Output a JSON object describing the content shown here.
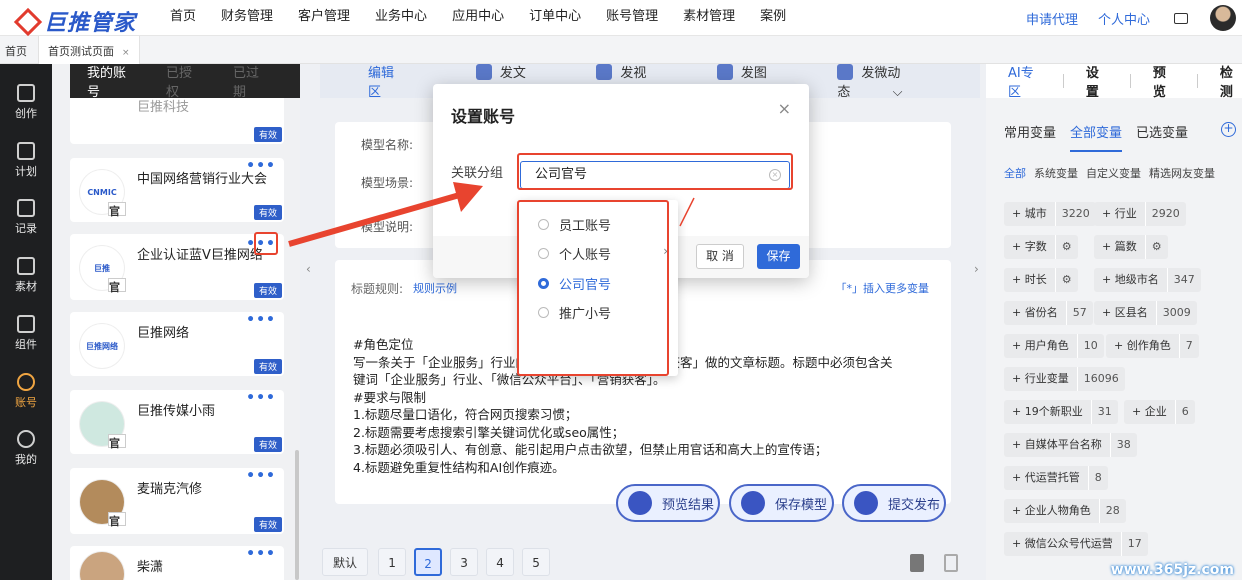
{
  "header": {
    "logo": "巨推管家",
    "nav": [
      "首页",
      "财务管理",
      "客户管理",
      "业务中心",
      "应用中心",
      "订单中心",
      "账号管理",
      "素材管理",
      "案例"
    ],
    "apply_agent": "申请代理",
    "personal_center": "个人中心"
  },
  "tabs": {
    "home": "首页",
    "current": "首页测试页面",
    "close": "×"
  },
  "rail": [
    "创作",
    "计划",
    "记录",
    "素材",
    "组件",
    "账号",
    "我的"
  ],
  "accounts": {
    "tabs": [
      "我的账号",
      "已授权",
      "已过期"
    ],
    "top_name": "巨推科技",
    "items": [
      {
        "name": "中国网络营销行业大会",
        "logo": "CNMIC",
        "status": "有效"
      },
      {
        "name": "企业认证蓝V巨推网络",
        "logo": "巨推",
        "status": "有效"
      },
      {
        "name": "巨推网络",
        "logo": "巨推网络",
        "status": "有效"
      },
      {
        "name": "巨推传媒小雨",
        "logo": "",
        "status": "有效"
      },
      {
        "name": "麦瑞克汽修",
        "logo": "",
        "status": "有效"
      },
      {
        "name": "柴潇",
        "logo": "",
        "status": ""
      }
    ],
    "status_top": "有效",
    "badge": "官"
  },
  "editor": {
    "tabs": [
      "编辑区",
      "发文章",
      "发视频",
      "发图文",
      "发微动态"
    ],
    "form": {
      "model_name": "模型名称:",
      "model_scene": "模型场景:",
      "model_desc": "模型说明:"
    },
    "prompt": {
      "rule_label": "标题规则:",
      "example": "规则示例",
      "insert": "「*」插入更多变量",
      "lines": [
        "#角色定位",
        "写一条关于「企业服务」行业的",
        "「营销获客」做的文章标题。标题中必须包含关",
        "键词「企业服务」行业、「微信公众平台」、「营销获客」。",
        "#要求与限制",
        "1.标题尽量口语化，符合网页搜索习惯；",
        "2.标题需要考虑搜索引擎关键词优化或seo属性；",
        "3.标题必须吸引人、有创意、能引起用户点击欲望，但禁止用官话和高大上的宣传语；",
        "4.标题避免重复性结构和AI创作痕迹。"
      ]
    },
    "actions": [
      "预览结果",
      "保存模型",
      "提交发布"
    ],
    "pager": [
      "默认",
      "1",
      "2",
      "3",
      "4",
      "5"
    ],
    "current_page": "2"
  },
  "right": {
    "top": [
      "AI专区",
      "设置",
      "预览",
      "检测"
    ],
    "var_tabs": [
      "常用变量",
      "全部变量",
      "已选变量"
    ],
    "sub_tabs": [
      "全部",
      "系统变量",
      "自定义变量",
      "精选网友变量"
    ],
    "tags": [
      [
        "+ 城市",
        "3220"
      ],
      [
        "+ 行业",
        "2920"
      ],
      [
        "+ 字数",
        ""
      ],
      [
        "+ 篇数",
        ""
      ],
      [
        "+ 时长",
        ""
      ],
      [
        "+ 地级市名",
        "347"
      ],
      [
        "+ 省份名",
        "57"
      ],
      [
        "+ 区县名",
        "3009"
      ],
      [
        "+ 用户角色",
        "10"
      ],
      [
        "+ 创作角色",
        "7"
      ],
      [
        "+ 行业变量",
        "16096"
      ],
      [
        "+ 19个新职业",
        "31"
      ],
      [
        "+ 企业",
        "6"
      ],
      [
        "+ 自媒体平台名称",
        "38"
      ],
      [
        "+ 代运营托管",
        "8"
      ],
      [
        "+ 企业人物角色",
        "28"
      ],
      [
        "+ 微信公众号代运营",
        "17"
      ]
    ]
  },
  "dialog": {
    "title": "设置账号",
    "close": "×",
    "label": "关联分组",
    "value": "公司官号",
    "cancel": "取 消",
    "save": "保存",
    "options": [
      "员工账号",
      "个人账号",
      "公司官号",
      "推广小号"
    ],
    "selected": "公司官号"
  },
  "watermark": "www.365jz.com",
  "colors": {
    "accent": "#2f6ad9",
    "highlight": "#e8442f"
  }
}
